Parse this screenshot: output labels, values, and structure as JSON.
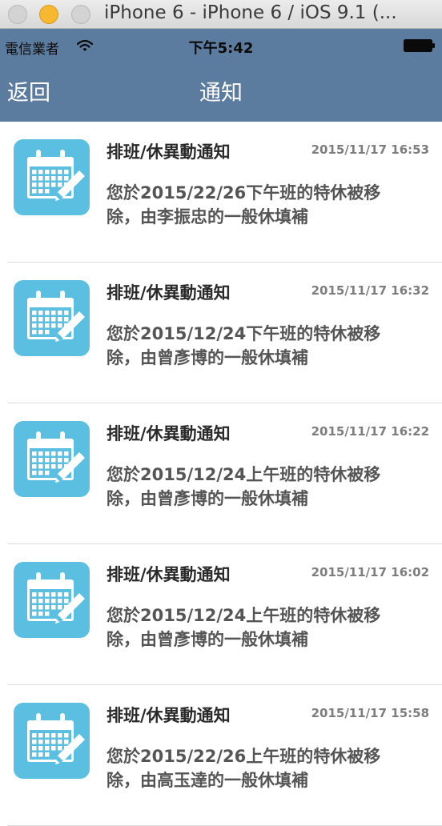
{
  "window": {
    "title": "iPhone 6 - iPhone 6 / iOS 9.1 (..."
  },
  "status_bar": {
    "carrier": "電信業者",
    "time": "下午5:42"
  },
  "nav": {
    "back_label": "返回",
    "title": "通知"
  },
  "colors": {
    "nav_background": "#5c7c9f",
    "icon_background": "#5bbfe2"
  },
  "notifications": [
    {
      "title": "排班/休異動通知",
      "time": "2015/11/17 16:53",
      "message": "您於2015/22/26下午班的特休被移\n除，由李振忠的一般休填補",
      "icon": "calendar-edit-icon"
    },
    {
      "title": "排班/休異動通知",
      "time": "2015/11/17 16:32",
      "message": "您於2015/12/24下午班的特休被移\n除，由曾彥博的一般休填補",
      "icon": "calendar-edit-icon"
    },
    {
      "title": "排班/休異動通知",
      "time": "2015/11/17 16:22",
      "message": "您於2015/12/24上午班的特休被移\n除，由曾彥博的一般休填補",
      "icon": "calendar-edit-icon"
    },
    {
      "title": "排班/休異動通知",
      "time": "2015/11/17 16:02",
      "message": "您於2015/12/24上午班的特休被移\n除，由曾彥博的一般休填補",
      "icon": "calendar-edit-icon"
    },
    {
      "title": "排班/休異動通知",
      "time": "2015/11/17 15:58",
      "message": "您於2015/22/26上午班的特休被移\n除，由高玉達的一般休填補",
      "icon": "calendar-edit-icon"
    }
  ]
}
